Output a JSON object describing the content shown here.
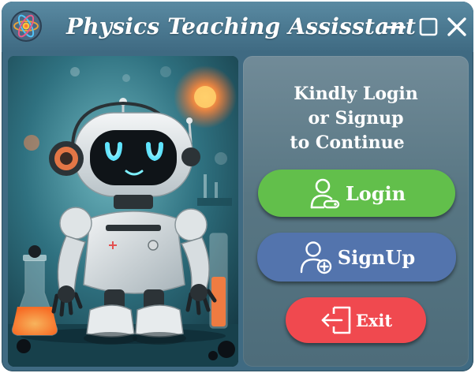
{
  "window": {
    "title": "Physics Teaching Assisstant",
    "icons": {
      "app": "atom-icon",
      "minimize": "minimize-icon",
      "maximize": "maximize-icon",
      "close": "close-icon"
    }
  },
  "illustration": {
    "subject": "robot-illustration"
  },
  "auth": {
    "prompt_line1": "Kindly Login",
    "prompt_line2": "or Signup",
    "prompt_line3": "to Continue",
    "login_label": "Login",
    "signup_label": "SignUp",
    "exit_label": "Exit",
    "login_icon": "user-key-icon",
    "signup_icon": "user-add-icon",
    "exit_icon": "exit-door-icon"
  },
  "colors": {
    "window_bg": "#3f6a82",
    "login": "#62bf4b",
    "signup": "#5374ad",
    "exit": "#f0494f",
    "text": "#ffffff"
  }
}
